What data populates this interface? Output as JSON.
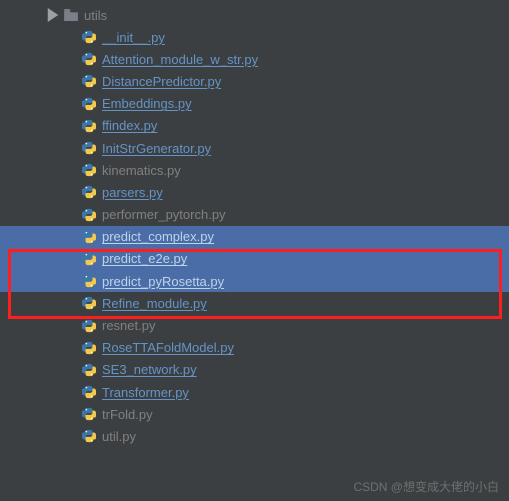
{
  "folder": {
    "name": "utils"
  },
  "files": [
    {
      "name": "__init__.py",
      "link": true,
      "selected": false
    },
    {
      "name": "Attention_module_w_str.py",
      "link": true,
      "selected": false
    },
    {
      "name": "DistancePredictor.py",
      "link": true,
      "selected": false
    },
    {
      "name": "Embeddings.py",
      "link": true,
      "selected": false
    },
    {
      "name": "ffindex.py",
      "link": true,
      "selected": false
    },
    {
      "name": "InitStrGenerator.py",
      "link": true,
      "selected": false
    },
    {
      "name": "kinematics.py",
      "link": false,
      "selected": false
    },
    {
      "name": "parsers.py",
      "link": true,
      "selected": false
    },
    {
      "name": "performer_pytorch.py",
      "link": false,
      "selected": false
    },
    {
      "name": "predict_complex.py",
      "link": true,
      "selected": true
    },
    {
      "name": "predict_e2e.py",
      "link": true,
      "selected": true
    },
    {
      "name": "predict_pyRosetta.py",
      "link": true,
      "selected": true
    },
    {
      "name": "Refine_module.py",
      "link": true,
      "selected": false
    },
    {
      "name": "resnet.py",
      "link": false,
      "selected": false
    },
    {
      "name": "RoseTTAFoldModel.py",
      "link": true,
      "selected": false
    },
    {
      "name": "SE3_network.py",
      "link": true,
      "selected": false
    },
    {
      "name": "Transformer.py",
      "link": true,
      "selected": false
    },
    {
      "name": "trFold.py",
      "link": false,
      "selected": false
    },
    {
      "name": "util.py",
      "link": false,
      "selected": false
    }
  ],
  "watermark": "CSDN @想变成大佬的小白"
}
